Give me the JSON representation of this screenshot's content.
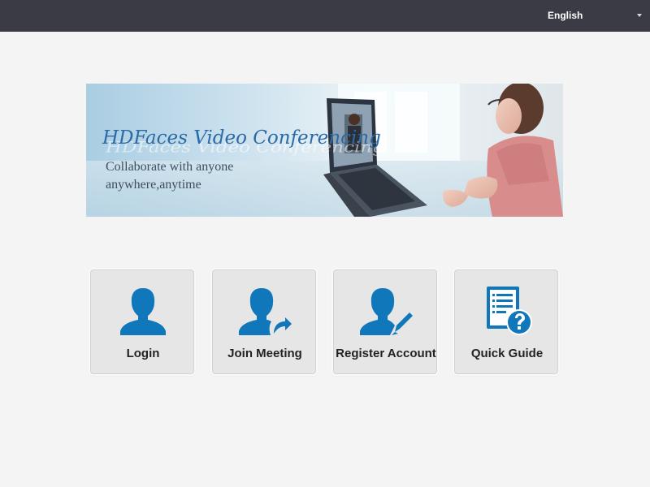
{
  "topbar": {
    "language": "English",
    "background": "#3a3b44"
  },
  "banner": {
    "title": "HDFaces Video Conferencing",
    "subtitle_line1": "Collaborate with anyone",
    "subtitle_line2": "anywhere,anytime"
  },
  "tiles": [
    {
      "label": "Login",
      "icon": "user-icon"
    },
    {
      "label": "Join Meeting",
      "icon": "user-arrow-icon"
    },
    {
      "label": "Register Account",
      "icon": "user-edit-icon"
    },
    {
      "label": "Quick Guide",
      "icon": "document-help-icon"
    }
  ],
  "colors": {
    "accent": "#1177bb",
    "page_background": "#f4f4f4",
    "tile_background": "#e6e6e6"
  }
}
